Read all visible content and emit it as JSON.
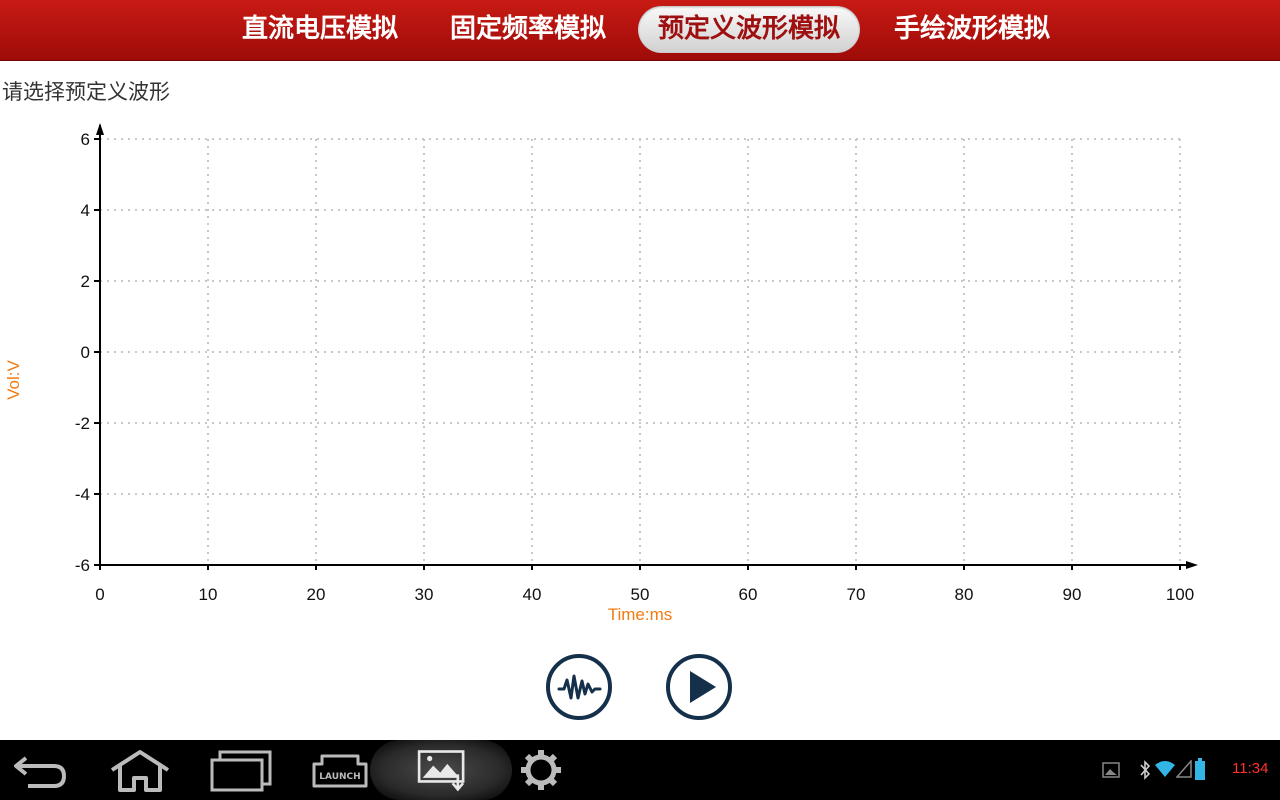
{
  "tabs": [
    {
      "label": "直流电压模拟",
      "active": false
    },
    {
      "label": "固定频率模拟",
      "active": false
    },
    {
      "label": "预定义波形模拟",
      "active": true
    },
    {
      "label": "手绘波形模拟",
      "active": false
    }
  ],
  "prompt": "请选择预定义波形",
  "chart_data": {
    "type": "line",
    "xlabel": "Time:ms",
    "ylabel": "Vol:V",
    "xlim": [
      0,
      100
    ],
    "ylim": [
      -6,
      6
    ],
    "x_ticks": [
      "0",
      "10",
      "20",
      "30",
      "40",
      "50",
      "60",
      "70",
      "80",
      "90",
      "100"
    ],
    "y_ticks": [
      "6",
      "4",
      "2",
      "0",
      "-2",
      "-4",
      "-6"
    ],
    "grid": true,
    "series": []
  },
  "controls": {
    "waveform_icon": "waveform-icon",
    "play_icon": "play-icon"
  },
  "navbar": {
    "icons": [
      "back-icon",
      "home-icon",
      "recent-apps-icon",
      "launch-icon",
      "screenshot-icon",
      "settings-icon"
    ],
    "status_icons": [
      "picture-notification-icon",
      "bluetooth-icon",
      "wifi-icon",
      "signal-icon",
      "battery-icon"
    ],
    "clock": "11:34"
  },
  "colors": {
    "header": "#b5120e",
    "axis_title": "#f27a12",
    "clock": "#ff3030",
    "button": "#14304a"
  }
}
